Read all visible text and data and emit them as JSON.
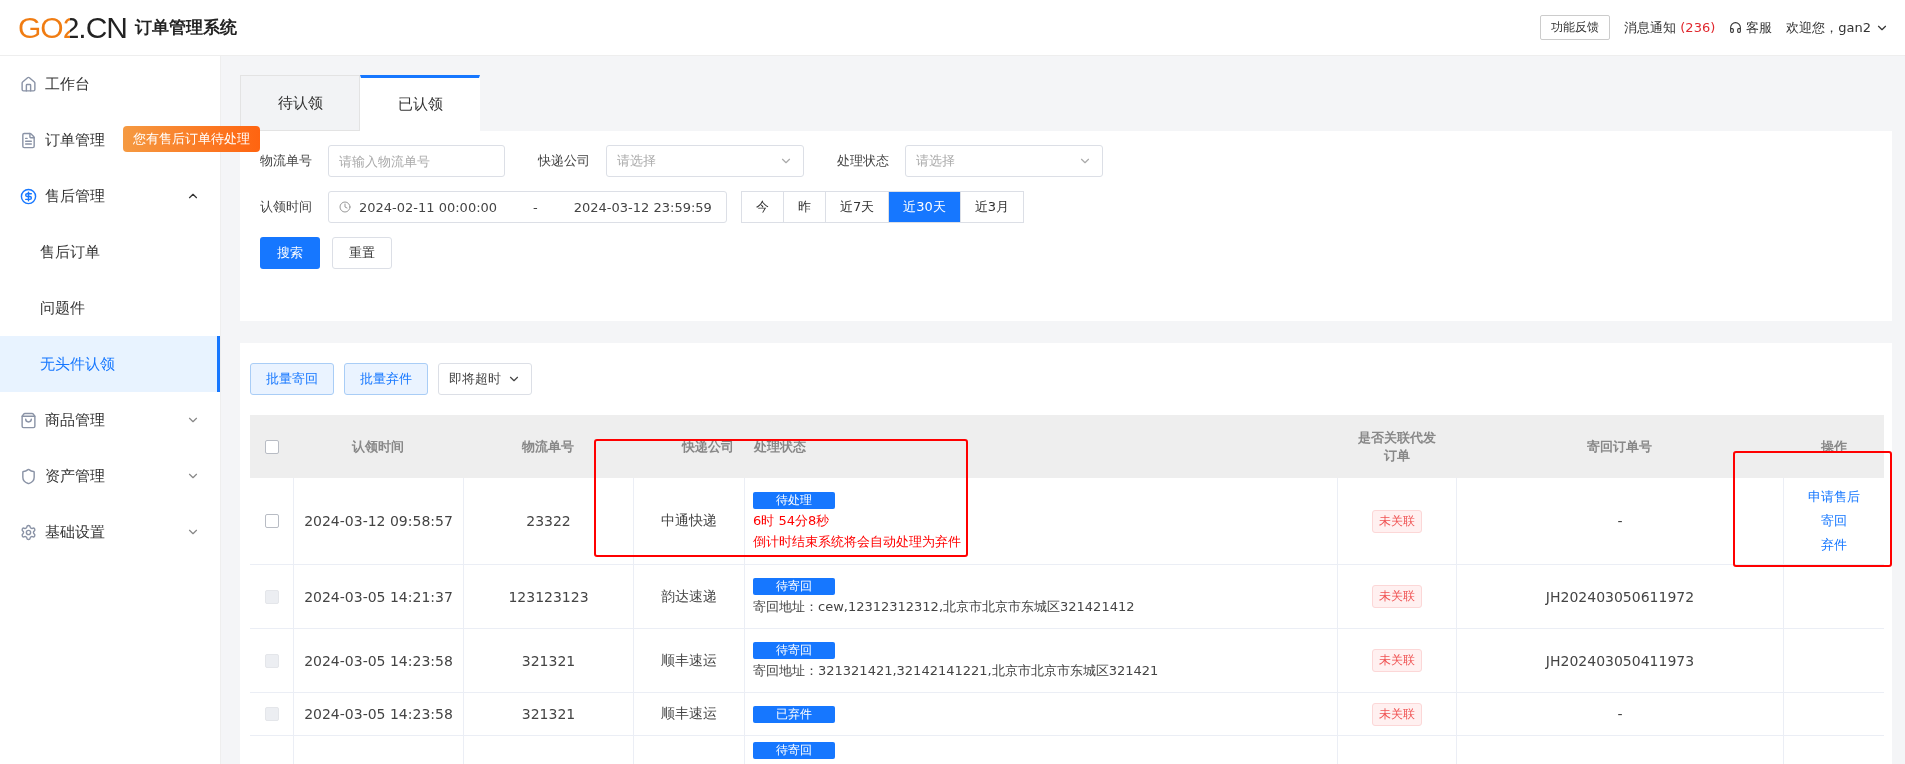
{
  "header": {
    "logo": "GO2.CN",
    "title": "订单管理系统",
    "feedback": "功能反馈",
    "notice": {
      "label": "消息通知",
      "count": "(236)"
    },
    "service": "客服",
    "user": "欢迎您，gan2"
  },
  "sidebar": {
    "items": [
      {
        "label": "工作台"
      },
      {
        "label": "订单管理",
        "tip": "您有售后订单待处理"
      },
      {
        "label": "售后管理",
        "expanded": true,
        "children": [
          {
            "label": "售后订单",
            "selected": false
          },
          {
            "label": "问题件",
            "selected": false
          },
          {
            "label": "无头件认领",
            "selected": true
          }
        ]
      },
      {
        "label": "商品管理",
        "expanded": false
      },
      {
        "label": "资产管理",
        "expanded": false
      },
      {
        "label": "基础设置",
        "expanded": false
      }
    ]
  },
  "tabs": [
    {
      "label": "待认领",
      "selected": false
    },
    {
      "label": "已认领",
      "selected": true
    }
  ],
  "filters": {
    "tracking": {
      "label": "物流单号",
      "placeholder": "请输入物流单号"
    },
    "courier": {
      "label": "快递公司",
      "placeholder": "请选择"
    },
    "status": {
      "label": "处理状态",
      "placeholder": "请选择"
    },
    "time": {
      "label": "认领时间",
      "start": "2024-02-11 00:00:00",
      "sep": "-",
      "end": "2024-03-12 23:59:59"
    },
    "quick": [
      {
        "label": "今",
        "selected": false
      },
      {
        "label": "昨",
        "selected": false
      },
      {
        "label": "近7天",
        "selected": false
      },
      {
        "label": "近30天",
        "selected": true
      },
      {
        "label": "近3月",
        "selected": false
      }
    ],
    "search": "搜索",
    "reset": "重置"
  },
  "toolbar": {
    "buttons": [
      "批量寄回",
      "批量弃件"
    ],
    "select": "即将超时"
  },
  "table": {
    "all_checked": false,
    "columns": [
      "认领时间",
      "物流单号",
      "快递公司",
      "处理状态",
      "是否关联代发订单",
      "寄回订单号",
      "操作"
    ],
    "rows": [
      {
        "disabled": false,
        "time": "2024-03-12 09:58:57",
        "tracking": "23322",
        "courier": "中通快递",
        "status": "待处理",
        "lines": [
          {
            "kind": "alert",
            "text": "6时 54分8秒"
          },
          {
            "kind": "alert",
            "text": "倒计时结束系统将会自动处理为弃件"
          }
        ],
        "linked": "未关联",
        "return_no": "-",
        "actions": [
          "申请售后",
          "寄回",
          "弃件"
        ]
      },
      {
        "disabled": true,
        "time": "2024-03-05 14:21:37",
        "tracking": "123123123",
        "courier": "韵达速递",
        "status": "待寄回",
        "lines": [
          {
            "kind": "info",
            "text": "寄回地址：cew,12312312312,北京市北京市东城区321421412"
          }
        ],
        "linked": "未关联",
        "return_no": "JH202403050611972",
        "actions": []
      },
      {
        "disabled": true,
        "time": "2024-03-05 14:23:58",
        "tracking": "321321",
        "courier": "顺丰速运",
        "status": "待寄回",
        "lines": [
          {
            "kind": "info",
            "text": "寄回地址：321321421,32142141221,北京市北京市东城区321421"
          }
        ],
        "linked": "未关联",
        "return_no": "JH202403050411973",
        "actions": []
      },
      {
        "disabled": true,
        "time": "2024-03-05 14:23:58",
        "tracking": "321321",
        "courier": "顺丰速运",
        "status": "已弃件",
        "lines": [],
        "linked": "未关联",
        "return_no": "-",
        "actions": []
      },
      {
        "status": "待寄回",
        "lines": [],
        "actions": []
      }
    ]
  }
}
